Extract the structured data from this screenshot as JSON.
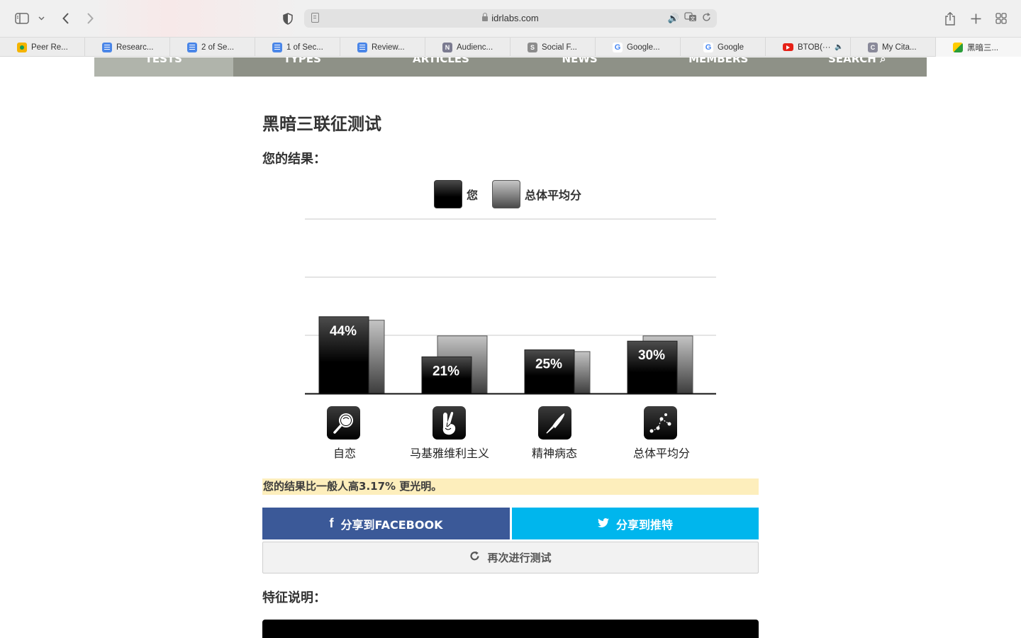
{
  "browser": {
    "url_host": "idrlabs.com",
    "bookmarks": [
      {
        "label": "Peer Re...",
        "icon": "classroom-icon"
      },
      {
        "label": "Researc...",
        "icon": "google-docs-icon"
      },
      {
        "label": "2 of Se...",
        "icon": "google-docs-icon"
      },
      {
        "label": "1 of Sec...",
        "icon": "google-docs-icon"
      },
      {
        "label": "Review...",
        "icon": "google-docs-icon"
      },
      {
        "label": "Audienc...",
        "icon": "n-icon"
      },
      {
        "label": "Social F...",
        "icon": "s-icon"
      },
      {
        "label": "Google...",
        "icon": "google-translate-icon"
      },
      {
        "label": "Google",
        "icon": "google-icon"
      },
      {
        "label": "BTOB(···",
        "icon": "youtube-icon"
      },
      {
        "label": "My Cita...",
        "icon": "c-icon"
      },
      {
        "label": "黑暗三...",
        "icon": "idrlabs-icon"
      }
    ]
  },
  "site_nav": [
    "TESTS",
    "TYPES",
    "ARTICLES",
    "NEWS",
    "MEMBERS",
    "SEARCH"
  ],
  "page": {
    "title": "黑暗三联征测试",
    "results_heading": "您的结果：",
    "legend_you": "您",
    "legend_avg": "总体平均分",
    "summary": "您的结果比一般人高3.17% 更光明。",
    "share_facebook": "分享到FACEBOOK",
    "share_twitter": "分享到推特",
    "retake": "再次进行测试",
    "traits_heading": "特征说明："
  },
  "chart_data": {
    "type": "bar",
    "categories": [
      "自恋",
      "马基雅维利主义",
      "精神病态",
      "总体平均分"
    ],
    "series": [
      {
        "name": "您",
        "values": [
          44,
          21,
          25,
          30
        ],
        "labels": [
          "44%",
          "21%",
          "25%",
          "30%"
        ]
      },
      {
        "name": "总体平均分",
        "values": [
          42,
          33,
          24,
          33
        ]
      }
    ],
    "ylim": [
      0,
      100
    ],
    "grid": true,
    "legend": "top-center",
    "icons": [
      "magnifying-glass-icon",
      "crossed-fingers-icon",
      "knife-icon",
      "graph-nodes-icon"
    ]
  }
}
